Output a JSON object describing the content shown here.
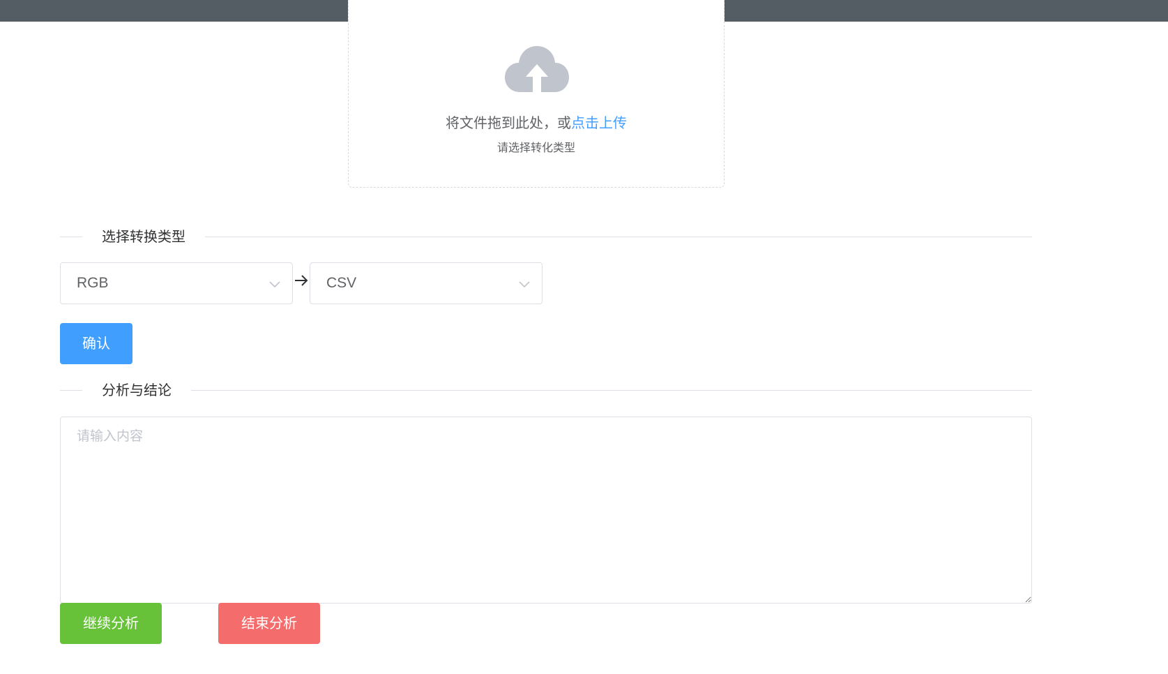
{
  "upload": {
    "icon": "cloud-upload-icon",
    "drag_text": "将文件拖到此处，或",
    "click_text": "点击上传",
    "tip": "请选择转化类型"
  },
  "convert_section": {
    "title": "选择转换类型",
    "from_value": "RGB",
    "to_value": "CSV",
    "arrow_icon": "arrow-right-icon",
    "confirm_label": "确认"
  },
  "analysis_section": {
    "title": "分析与结论",
    "placeholder": "请输入内容",
    "continue_label": "继续分析",
    "end_label": "结束分析"
  },
  "colors": {
    "primary": "#409eff",
    "success": "#67c23a",
    "danger": "#f56c6c",
    "topbar": "#545c64"
  }
}
